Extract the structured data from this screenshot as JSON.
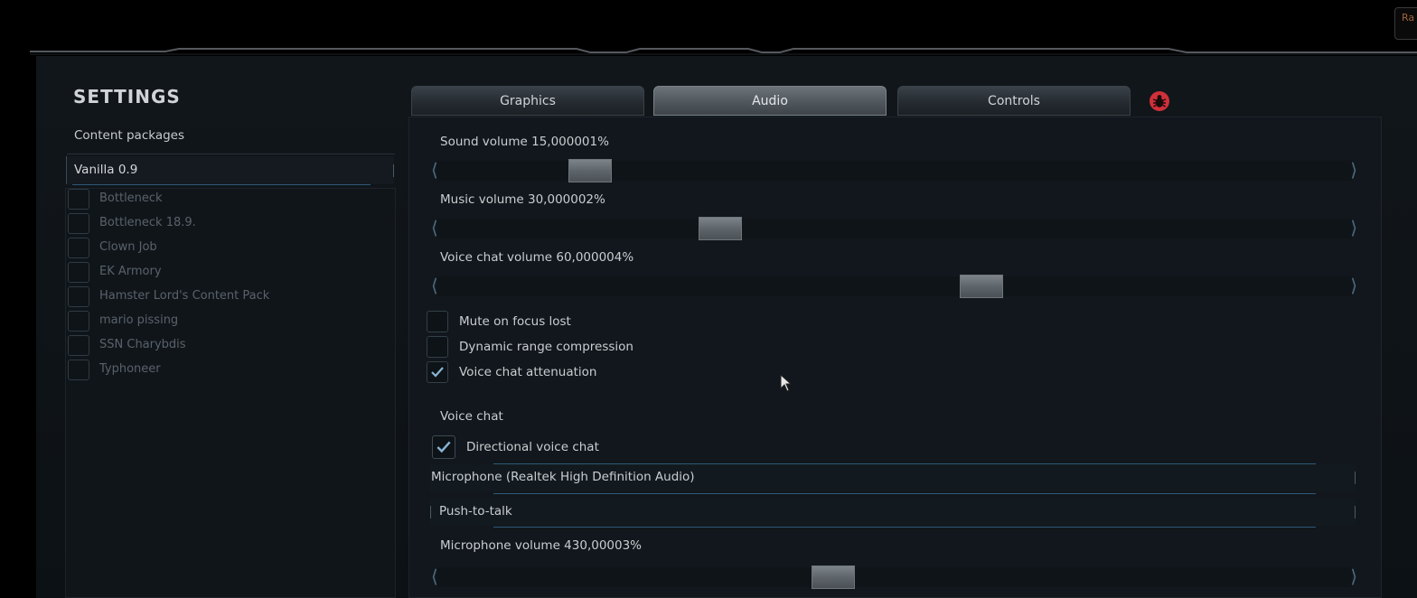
{
  "window": {
    "title": "SETTINGS",
    "corner_tag": "Ra"
  },
  "sidebar": {
    "label": "Content packages",
    "core_package": "Vanilla 0.9",
    "packages": [
      {
        "name": "Bottleneck",
        "checked": false
      },
      {
        "name": "Bottleneck 18.9.",
        "checked": false
      },
      {
        "name": "Clown Job",
        "checked": false
      },
      {
        "name": "EK Armory",
        "checked": false
      },
      {
        "name": "Hamster Lord's Content Pack",
        "checked": false
      },
      {
        "name": "mario pissing",
        "checked": false
      },
      {
        "name": "SSN Charybdis",
        "checked": false
      },
      {
        "name": "Typhoneer",
        "checked": false
      }
    ]
  },
  "tabs": [
    {
      "label": "Graphics",
      "active": false
    },
    {
      "label": "Audio",
      "active": true
    },
    {
      "label": "Controls",
      "active": false
    }
  ],
  "bug_report_icon": "bug-icon",
  "audio": {
    "sound_volume_label": "Sound volume 15,000001%",
    "sound_volume_value": 15.000001,
    "music_volume_label": "Music volume 30,000002%",
    "music_volume_value": 30.000002,
    "voice_chat_volume_label": "Voice chat volume 60,000004%",
    "voice_chat_volume_value": 60.000004,
    "mute_on_focus_lost": {
      "label": "Mute on focus lost",
      "checked": false
    },
    "dynamic_range_compression": {
      "label": "Dynamic range compression",
      "checked": false
    },
    "voice_chat_attenuation": {
      "label": "Voice chat attenuation",
      "checked": true
    }
  },
  "voice_chat": {
    "header": "Voice chat",
    "directional": {
      "label": "Directional voice chat",
      "checked": true
    },
    "microphone_device": "Microphone (Realtek High Definition Audio)",
    "mode": "Push-to-talk",
    "microphone_volume_label": "Microphone volume 430,00003%",
    "microphone_volume_value": 430.00003
  },
  "colors": {
    "accent_blue": "#2e5a78",
    "bug_icon_red": "#d0303a"
  }
}
